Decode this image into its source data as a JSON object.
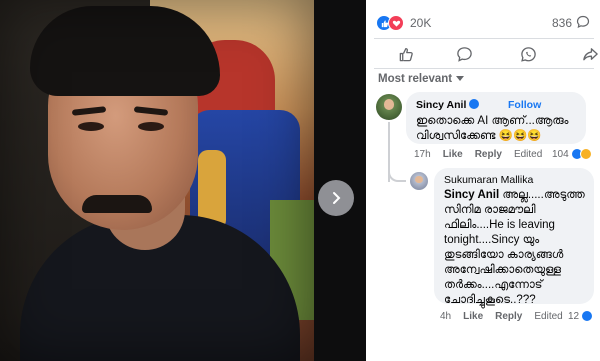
{
  "post": {
    "reaction_count": "20K",
    "comment_count": "836",
    "sort_label": "Most relevant"
  },
  "icons": {
    "like": "like-icon",
    "love": "love-icon",
    "comment": "comment-icon",
    "whatsapp": "whatsapp-icon",
    "share": "share-icon",
    "next": "chevron-right-icon"
  },
  "colors": {
    "fb_blue": "#1877f2",
    "love_red": "#f33e58",
    "haha_yellow": "#f7b125"
  },
  "comments": [
    {
      "author": "Sincy Anil",
      "follow_label": "Follow",
      "text": "ഇതൊക്കെ AI ആണ്...ആരും വിശ്വസിക്കേണ്ട 😆😆😆",
      "time": "17h",
      "like_label": "Like",
      "reply_label": "Reply",
      "edited_label": "Edited",
      "reactions": "104"
    },
    {
      "author": "Sukumaran Mallika",
      "mention": "Sincy Anil",
      "text": " അല്ല.....അടുത്ത സിനിമ രാജമൗലി ഫിലിം....He is leaving tonight....Sincy യും തുടങ്ങിയോ കാര്യങ്ങൾ അന്വേഷിക്കാതെയുള്ള തർക്കം....എന്നോട് ചോദിച്ചുകൂടെ..???",
      "time": "4h",
      "like_label": "Like",
      "reply_label": "Reply",
      "edited_label": "Edited",
      "reactions": "12"
    }
  ]
}
